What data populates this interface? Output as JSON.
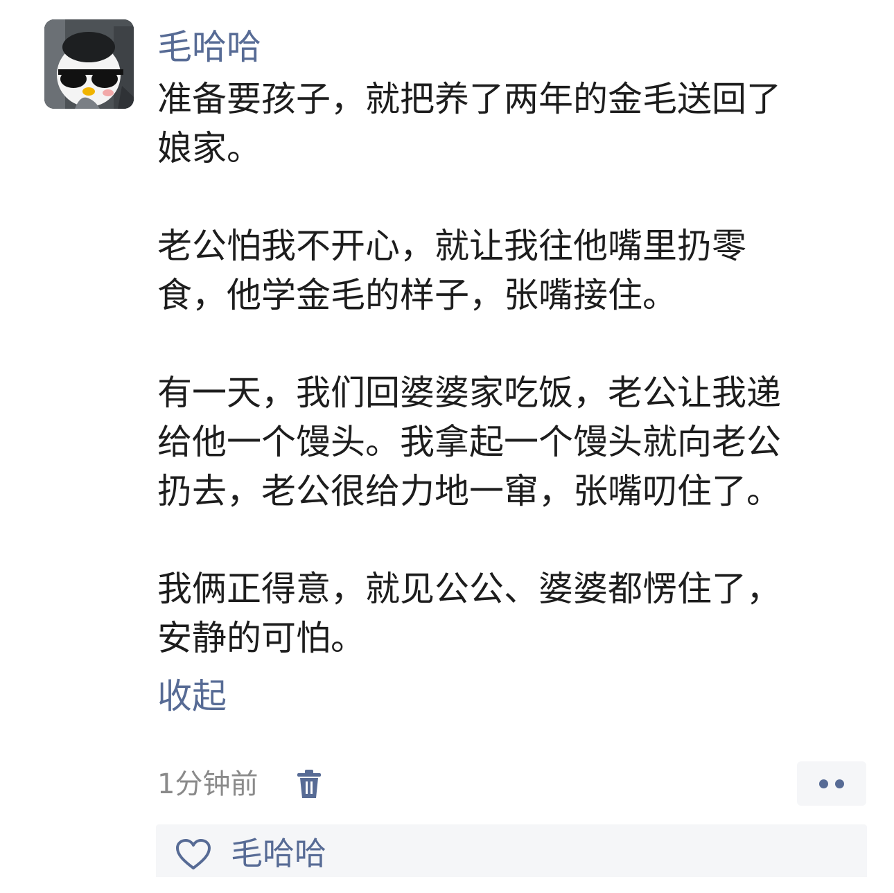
{
  "post": {
    "author": "毛哈哈",
    "avatar_icon": "penguin-sunglasses-avatar",
    "paragraphs": [
      "准备要孩子，就把养了两年的金毛送回了\n娘家。",
      "老公怕我不开心，就让我往他嘴里扔零\n食，他学金毛的样子，张嘴接住。",
      "有一天，我们回婆婆家吃饭，老公让我递\n给他一个馒头。我拿起一个馒头就向老公\n扔去，老公很给力地一窜，张嘴叨住了。",
      "我俩正得意，就见公公、婆婆都愣住了，\n安静的可怕。"
    ],
    "collapse_label": "收起",
    "timestamp": "1分钟前"
  },
  "actions": {
    "delete_icon": "trash-icon",
    "more_icon": "more-dots-icon"
  },
  "likes": {
    "icon": "heart-icon",
    "names": "毛哈哈"
  },
  "colors": {
    "link": "#576b95",
    "text": "#1d1d1d",
    "meta": "#8a8a8a",
    "panel": "#f5f6f8"
  }
}
